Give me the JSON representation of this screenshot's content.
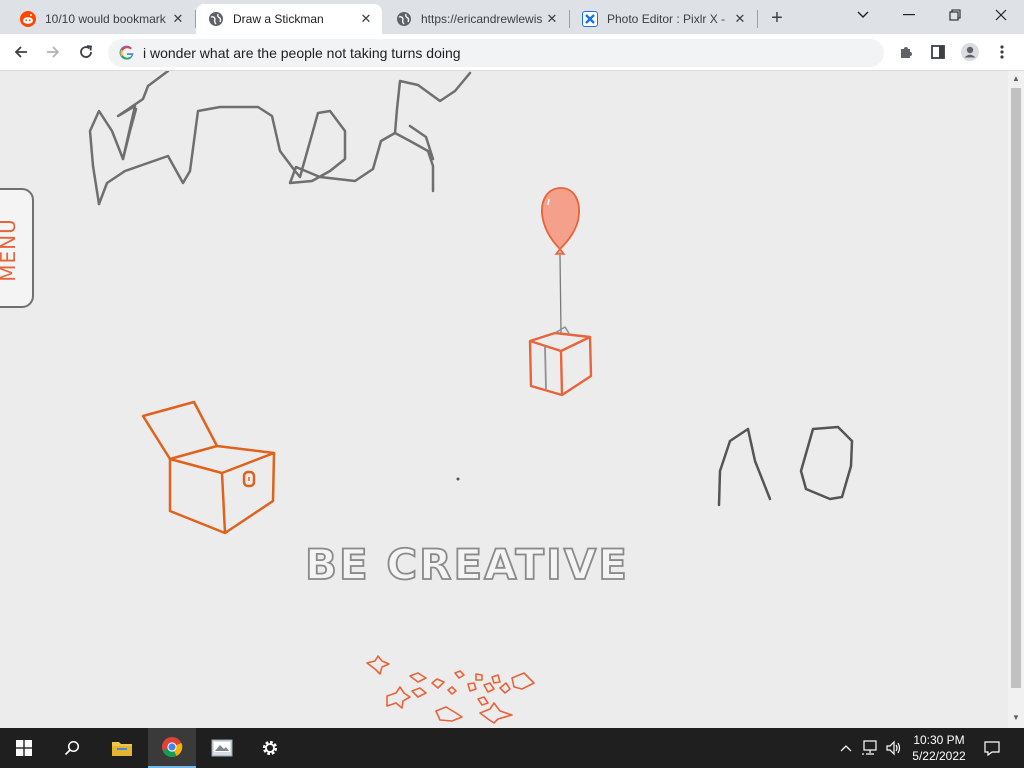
{
  "browser": {
    "tabs": [
      {
        "title": "10/10 would bookmark",
        "favicon": "reddit-icon",
        "color": "#ff4500",
        "active": false
      },
      {
        "title": "Draw a Stickman",
        "favicon": "globe-icon",
        "color": "#5f6368",
        "active": true
      },
      {
        "title": "https://ericandrewlewis",
        "favicon": "globe-icon",
        "color": "#5f6368",
        "active": false
      },
      {
        "title": "Photo Editor : Pixlr X -",
        "favicon": "pixlr-icon",
        "color": "#1a73e8",
        "active": false
      }
    ],
    "address_bar": {
      "value": "i wonder what are the people not taking turns doing"
    }
  },
  "page": {
    "menu_label": "MENU",
    "doodle_text": "BE CREATIVE",
    "accent_color": "#e8643a",
    "sketch_color": "#6f6f6f"
  },
  "taskbar": {
    "time": "10:30 PM",
    "date": "5/22/2022"
  }
}
